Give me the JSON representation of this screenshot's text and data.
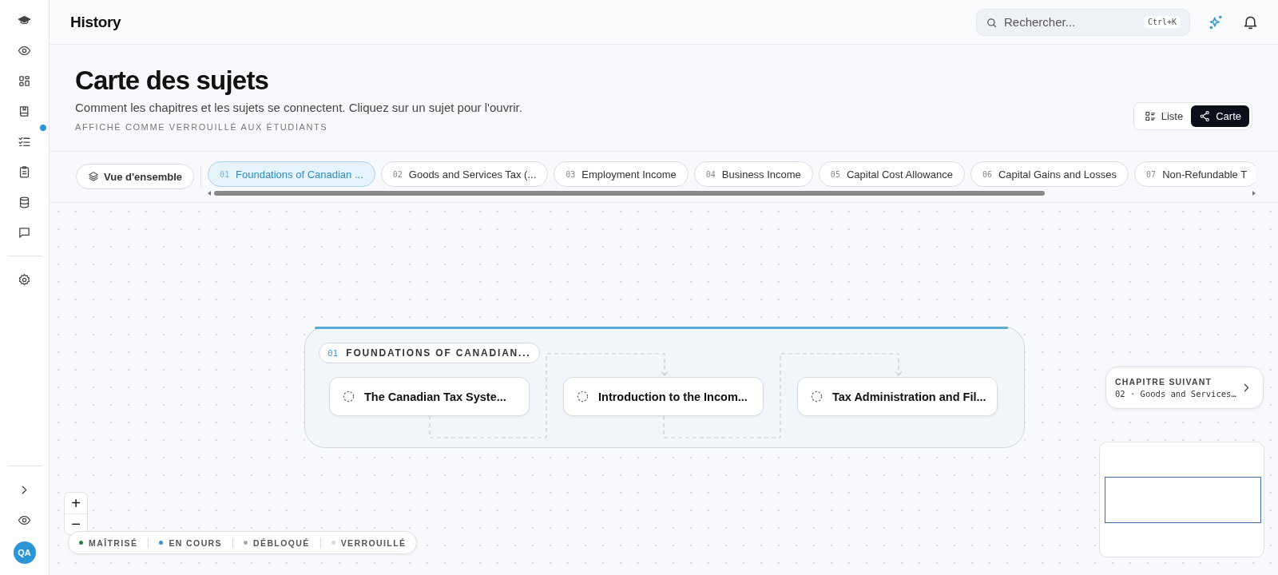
{
  "sidebar": {
    "items": [
      {
        "notification": false
      },
      {
        "notification": false
      },
      {
        "notification": false
      },
      {
        "notification": false
      },
      {
        "notification": true
      },
      {
        "notification": false
      },
      {
        "notification": false
      },
      {
        "notification": false
      },
      {
        "notification": false
      }
    ],
    "avatar": "QA"
  },
  "header": {
    "title": "History",
    "search": {
      "placeholder": "Rechercher...",
      "shortcut": "Ctrl+K"
    }
  },
  "page": {
    "title": "Carte des sujets",
    "subtitle": "Comment les chapitres et les sujets se connectent. Cliquez sur un sujet pour l'ouvrir.",
    "notice": "AFFICHÉ COMME VERROUILLÉ AUX ÉTUDIANTS",
    "views": [
      {
        "label": "Liste",
        "selected": false
      },
      {
        "label": "Carte",
        "selected": true
      }
    ]
  },
  "overview": {
    "label": "Vue d'ensemble"
  },
  "chapter_tabs": [
    {
      "number": "01",
      "label": "Foundations of Canadian ...",
      "selected": true
    },
    {
      "number": "02",
      "label": "Goods and Services Tax (...",
      "selected": false
    },
    {
      "number": "03",
      "label": "Employment Income",
      "selected": false
    },
    {
      "number": "04",
      "label": "Business Income",
      "selected": false
    },
    {
      "number": "05",
      "label": "Capital Cost Allowance",
      "selected": false
    },
    {
      "number": "06",
      "label": "Capital Gains and Losses",
      "selected": false
    },
    {
      "number": "07",
      "label": "Non-Refundable T",
      "selected": false
    }
  ],
  "map": {
    "chapter": {
      "number": "01",
      "title": "FOUNDATIONS OF CANADIAN..."
    },
    "topics": [
      {
        "title": "The Canadian Tax Syste..."
      },
      {
        "title": "Introduction to the Incom..."
      },
      {
        "title": "Tax Administration and Fil..."
      }
    ],
    "next_chapter": {
      "label": "CHAPITRE SUIVANT",
      "title": "02 · Goods and Services…"
    },
    "zoom": [
      "+",
      "−"
    ],
    "legend": [
      {
        "label": "MAÎTRISÉ",
        "color": "#1e8a3c"
      },
      {
        "label": "EN COURS",
        "color": "#3a93cf"
      },
      {
        "label": "DÉBLOQUÉ",
        "color": "#a8a8a8"
      },
      {
        "label": "VERROUILLÉ",
        "color": "#d8d8d8"
      }
    ]
  }
}
